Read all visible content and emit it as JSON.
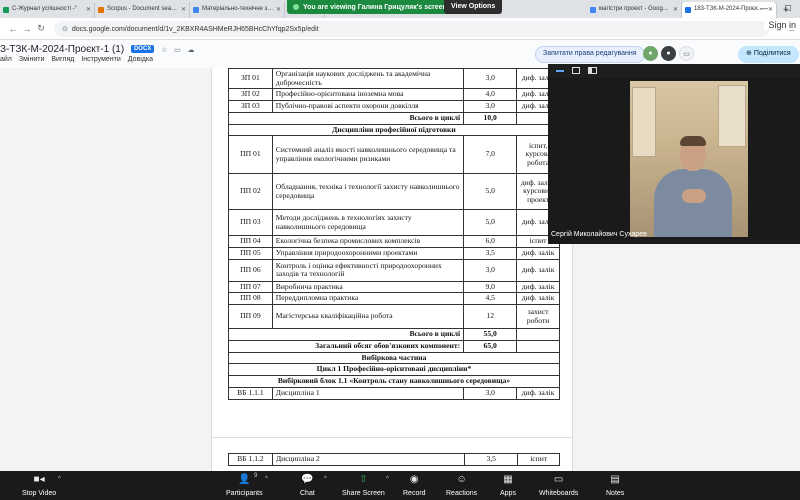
{
  "browser": {
    "tabs": [
      {
        "label": "С-Журнал успішності -“",
        "favicon_color": "#0f9d58",
        "active": false
      },
      {
        "label": "Scopus - Document sea…",
        "favicon_color": "#e37400",
        "active": false
      },
      {
        "label": "Матеріально-технічне з…",
        "favicon_color": "#4285f4",
        "active": false
      },
      {
        "label": "Ре",
        "favicon_color": "#a142f4",
        "active": false
      },
      {
        "label": "магістри проект - Goog…",
        "favicon_color": "#4285f4",
        "active": false
      },
      {
        "label": "183-ТЗК-М-2024-Проєк…",
        "favicon_color": "#1a73e8",
        "active": true
      }
    ],
    "new_tab": "+",
    "url": "docs.google.com/document/d/1v_2KBXR4ASHMeRJH65BHcChYfqp2Sx5p/edit",
    "sign_in": "Sign in"
  },
  "banner": {
    "viewing_text": "You are viewing Галина Грицуляк's screen",
    "view_options": "View Options"
  },
  "docs": {
    "title": "З-ТЗК-М-2024-Проєкт-1 (1)",
    "badge": "DOCX",
    "menus": [
      "айл",
      "Змінити",
      "Вигляд",
      "Інструменти",
      "Довідка"
    ],
    "request_edit": "Запитати права редагування",
    "share": "Поділитися"
  },
  "table": {
    "rows_top": [
      {
        "code": "ЗП 01",
        "name": "Організація наукових досліджень та академічна доброчесність",
        "credits": "3,0",
        "control": "диф. залік"
      },
      {
        "code": "ЗП 02",
        "name": "Професійно-орієнтована іноземна мова",
        "credits": "4,0",
        "control": "диф. залік"
      },
      {
        "code": "ЗП 03",
        "name": "Публічно-правові аспекти охорони довкілля",
        "credits": "3,0",
        "control": "диф. залік"
      }
    ],
    "subtotal1": {
      "label": "Всього в циклі",
      "value": "10,0"
    },
    "section_prof": "Дисципліни професійної підготовки",
    "rows_prof": [
      {
        "code": "ПП 01",
        "name": "Системний аналіз якості навколишнього середовища та управління екологічними ризиками",
        "credits": "7,0",
        "control": "іспит, курсова робота"
      },
      {
        "code": "ПП 02",
        "name": "Обладнання, техніка і технології захисту навколишнього середовища",
        "credits": "5,0",
        "control": "диф. залік, курсовий проект"
      },
      {
        "code": "ПП 03",
        "name": "Методи досліджень в технологіях захисту навколишнього середовища",
        "credits": "5,0",
        "control": "диф. залік"
      },
      {
        "code": "ПП 04",
        "name": "Екологічна безпека промислових комплексів",
        "credits": "6,0",
        "control": "іспит"
      },
      {
        "code": "ПП 05",
        "name": "Управління природоохоронними проектами",
        "credits": "3,5",
        "control": "диф. залік"
      },
      {
        "code": "ПП 06",
        "name": "Контроль і оцінка ефективності природоохоронних заходів та технологій",
        "credits": "3,0",
        "control": "диф. залік"
      },
      {
        "code": "ПП 07",
        "name": "Виробнича практика",
        "credits": "9,0",
        "control": "диф. залік"
      },
      {
        "code": "ПП 08",
        "name": "Переддипломна практика",
        "credits": "4,5",
        "control": "диф. залік"
      },
      {
        "code": "ПП 09",
        "name": "Магістерська кваліфікаційна робота",
        "credits": "12",
        "control": "захист роботи"
      }
    ],
    "subtotal2": {
      "label": "Всього в циклі",
      "value": "55,0"
    },
    "total_mandatory": {
      "label": "Загальний обсяг обов'язкових компонент:",
      "value": "65,0"
    },
    "elective_header": "Вибіркова частина",
    "cycle1_header": "Цикл 1 Професійно-орієнтовані дисципліни*",
    "block_header": "Вибірковий блок 1.1 «Контроль стану навколишнього середовища»",
    "row_vb1": {
      "code": "ВБ 1.1.1",
      "name": "Дисципліна 1",
      "credits": "3,0",
      "control": "диф. залік"
    },
    "row_vb2": {
      "code": "ВБ 1.1.2",
      "name": "Дисципліна 2",
      "credits": "3,5",
      "control": "іспит"
    }
  },
  "video": {
    "participant_name": "Сергій Миколайович Сухарев"
  },
  "zoom_toolbar": {
    "items": [
      {
        "label": "Stop Video",
        "icon": "video-camera-icon"
      },
      {
        "label": "Participants",
        "icon": "participants-icon",
        "count": "9"
      },
      {
        "label": "Chat",
        "icon": "chat-icon"
      },
      {
        "label": "Share Screen",
        "icon": "share-screen-icon"
      },
      {
        "label": "Record",
        "icon": "record-icon"
      },
      {
        "label": "Reactions",
        "icon": "reactions-icon"
      },
      {
        "label": "Apps",
        "icon": "apps-icon"
      },
      {
        "label": "Whiteboards",
        "icon": "whiteboard-icon"
      },
      {
        "label": "Notes",
        "icon": "notes-icon"
      }
    ],
    "share_color": "#29b35b"
  }
}
